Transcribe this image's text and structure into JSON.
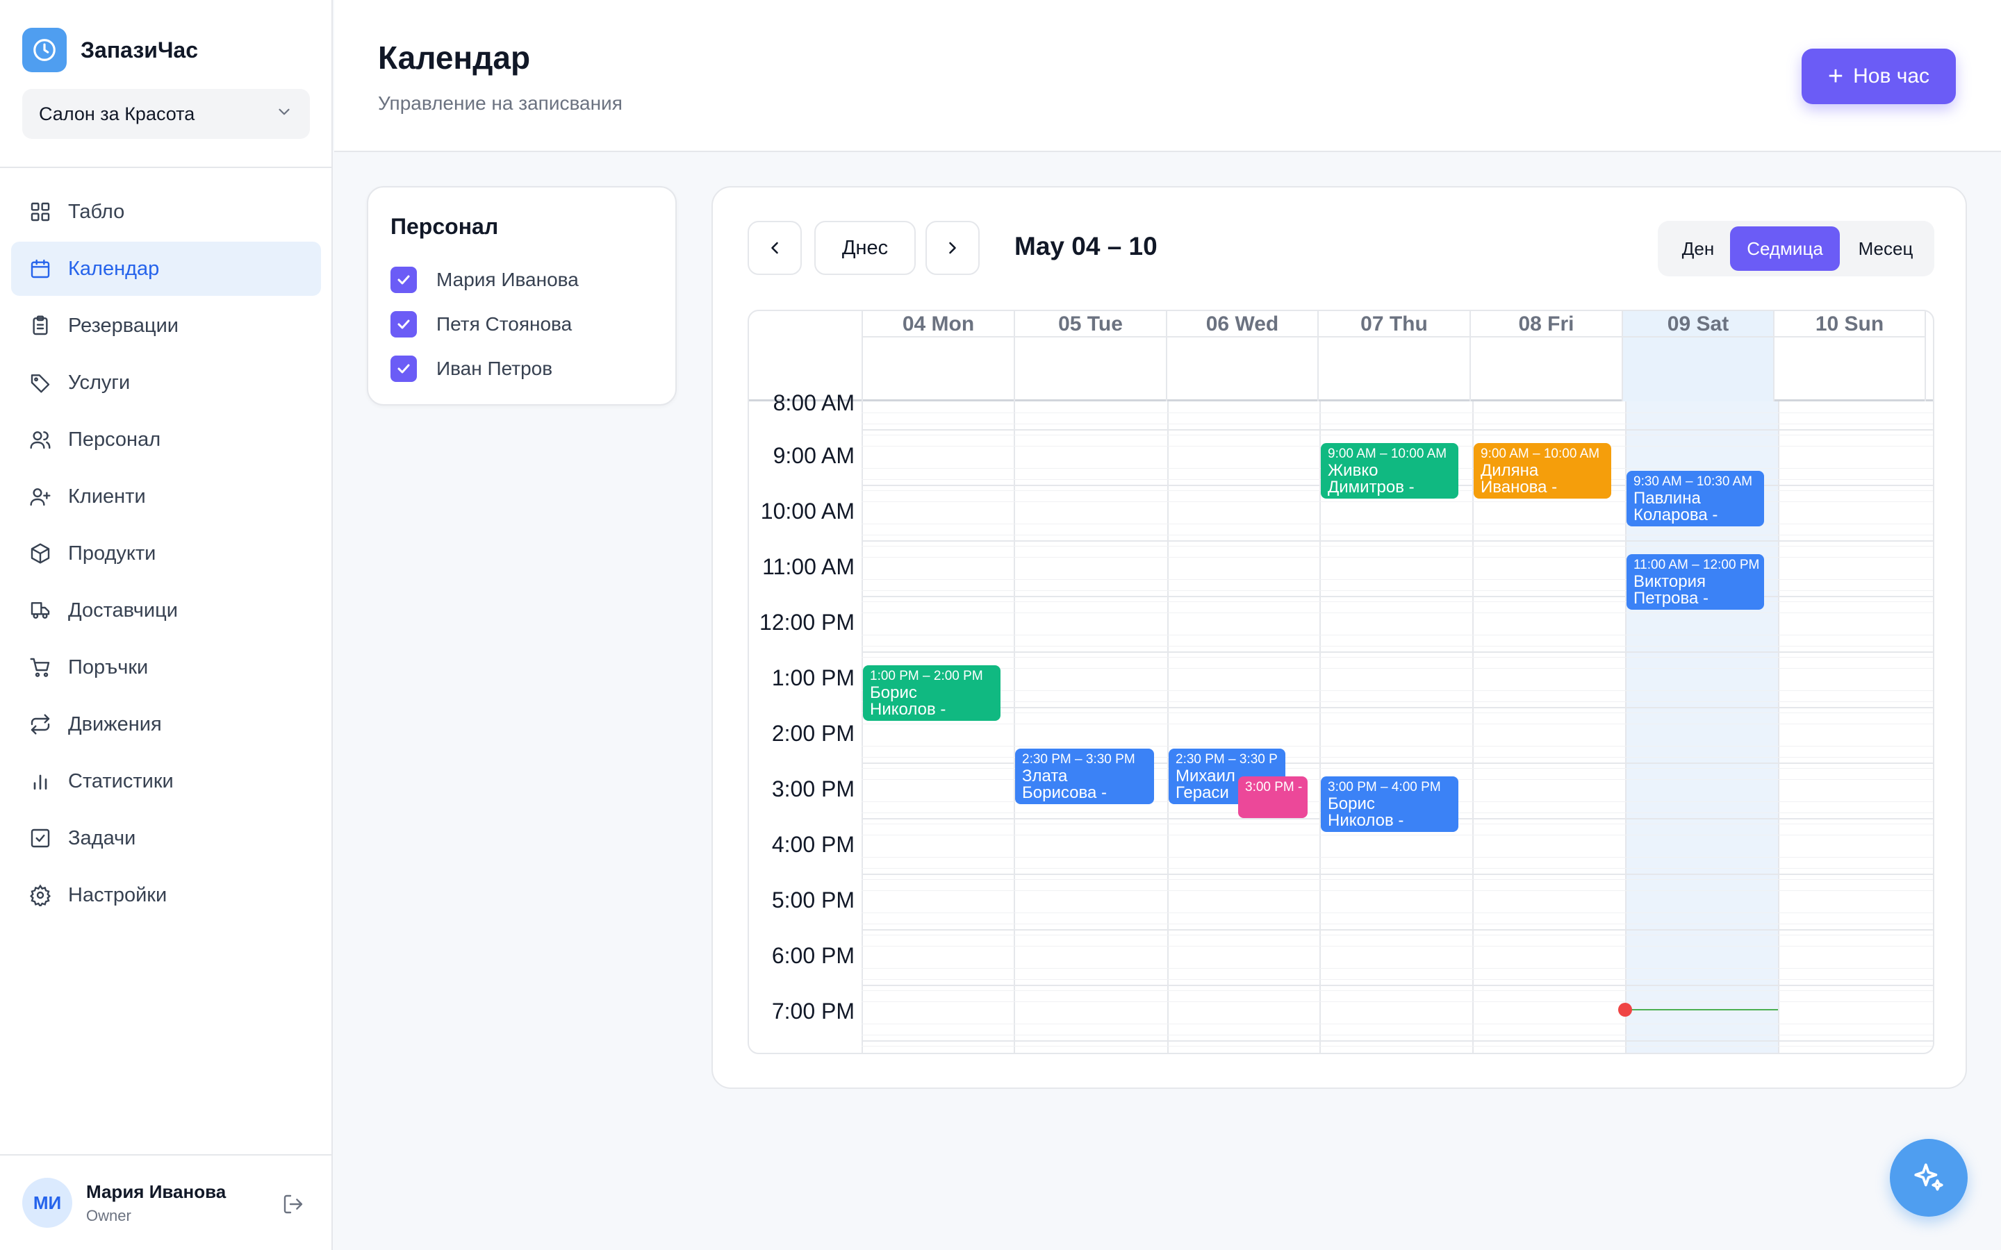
{
  "brand": {
    "name": "ЗапазиЧас",
    "icon": "clock-icon"
  },
  "salon": {
    "selected": "Салон за Красота"
  },
  "nav": {
    "items": [
      {
        "label": "Табло",
        "icon": "dashboard-icon"
      },
      {
        "label": "Календар",
        "icon": "calendar-icon",
        "active": true
      },
      {
        "label": "Резервации",
        "icon": "clipboard-icon"
      },
      {
        "label": "Услуги",
        "icon": "tag-icon"
      },
      {
        "label": "Персонал",
        "icon": "users-icon"
      },
      {
        "label": "Клиенти",
        "icon": "user-plus-icon"
      },
      {
        "label": "Продукти",
        "icon": "box-icon"
      },
      {
        "label": "Доставчици",
        "icon": "truck-icon"
      },
      {
        "label": "Поръчки",
        "icon": "cart-icon"
      },
      {
        "label": "Движения",
        "icon": "repeat-icon"
      },
      {
        "label": "Статистики",
        "icon": "bar-chart-icon"
      },
      {
        "label": "Задачи",
        "icon": "check-square-icon"
      },
      {
        "label": "Настройки",
        "icon": "gear-icon"
      }
    ]
  },
  "user": {
    "initials": "МИ",
    "name": "Мария Иванова",
    "role": "Owner"
  },
  "header": {
    "title": "Календар",
    "subtitle": "Управление на записвания",
    "new_button": "Нов час"
  },
  "staff": {
    "title": "Персонал",
    "members": [
      {
        "name": "Мария Иванова",
        "checked": true
      },
      {
        "name": "Петя Стоянова",
        "checked": true
      },
      {
        "name": "Иван Петров",
        "checked": true
      }
    ]
  },
  "calendar": {
    "today_button": "Днес",
    "range_label": "May 04 – 10",
    "views": [
      "Ден",
      "Седмица",
      "Месец"
    ],
    "active_view": "Седмица",
    "days": [
      "04 Mon",
      "05 Tue",
      "06 Wed",
      "07 Thu",
      "08 Fri",
      "09 Sat",
      "10 Sun"
    ],
    "today_day": "09 Sat",
    "hours": [
      "8:00 AM",
      "9:00 AM",
      "10:00 AM",
      "11:00 AM",
      "12:00 PM",
      "1:00 PM",
      "2:00 PM",
      "3:00 PM",
      "4:00 PM",
      "5:00 PM",
      "6:00 PM",
      "7:00 PM"
    ],
    "events": [
      {
        "day": 3,
        "time": "9:00 AM – 10:00 AM",
        "line1": "Живко",
        "line2": "Димитров -",
        "color": "#10b981"
      },
      {
        "day": 4,
        "time": "9:00 AM – 10:00 AM",
        "line1": "Диляна",
        "line2": "Иванова -",
        "color": "#f59e0b"
      },
      {
        "day": 5,
        "time": "9:30 AM – 10:30 AM",
        "line1": "Павлина",
        "line2": "Коларова -",
        "color": "#3b82f6"
      },
      {
        "day": 5,
        "time": "11:00 AM – 12:00 PM",
        "line1": "Виктория",
        "line2": "Петрова -",
        "color": "#3b82f6"
      },
      {
        "day": 0,
        "time": "1:00 PM – 2:00 PM",
        "line1": "Борис",
        "line2": "Николов -",
        "color": "#10b981"
      },
      {
        "day": 1,
        "time": "2:30 PM – 3:30 PM",
        "line1": "Злата",
        "line2": "Борисова -",
        "color": "#3b82f6"
      },
      {
        "day": 2,
        "time": "2:30 PM – 3:30 P",
        "line1": "Михаил",
        "line2": "Гераси",
        "color": "#3b82f6"
      },
      {
        "day": 2,
        "time": "3:00 PM -",
        "line1": "",
        "line2": "",
        "color": "#ec4899"
      },
      {
        "day": 3,
        "time": "3:00 PM – 4:00 PM",
        "line1": "Борис",
        "line2": "Николов -",
        "color": "#3b82f6"
      }
    ]
  },
  "colors": {
    "accent": "#6b5cf6",
    "primary_blue": "#4f9ef0",
    "active_nav_bg": "#e8f1fc",
    "today_col_bg": "#ebf3fc",
    "now_dot": "#ef4444",
    "now_line": "#4caf50"
  },
  "fab": {
    "icon": "sparkles-icon"
  }
}
